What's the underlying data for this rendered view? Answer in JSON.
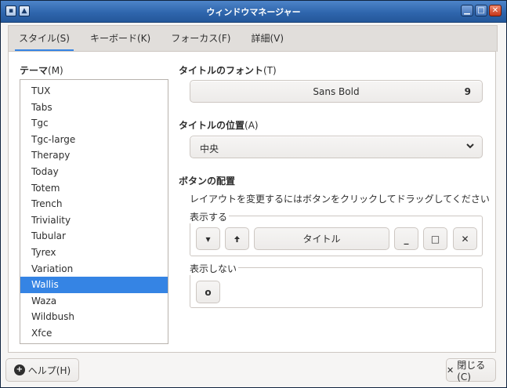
{
  "window": {
    "title": "ウィンドウマネージャー",
    "icons": [
      "app-menu-icon",
      "pin-icon"
    ],
    "controls": {
      "minimize": "▁",
      "maximize": "□",
      "close": "✕"
    }
  },
  "tabs": [
    {
      "label": "スタイル(S)",
      "active": true
    },
    {
      "label": "キーボード(K)",
      "active": false
    },
    {
      "label": "フォーカス(F)",
      "active": false
    },
    {
      "label": "詳細(V)",
      "active": false
    }
  ],
  "theme": {
    "label_main": "テーマ",
    "label_key": "(M)",
    "items": [
      "TUX",
      "Tabs",
      "Tgc",
      "Tgc-large",
      "Therapy",
      "Today",
      "Totem",
      "Trench",
      "Triviality",
      "Tubular",
      "Tyrex",
      "Variation",
      "Wallis",
      "Waza",
      "Wildbush",
      "Xfce"
    ],
    "selected": "Wallis"
  },
  "title_font": {
    "label_main": "タイトルのフォント",
    "label_key": "(T)",
    "font_name": "Sans Bold",
    "font_size": "9"
  },
  "title_position": {
    "label_main": "タイトルの位置",
    "label_key": "(A)",
    "value": "中央"
  },
  "button_layout": {
    "label": "ボタンの配置",
    "hint": "レイアウトを変更するにはボタンをクリックしてドラッグしてください",
    "shown_label": "表示する",
    "hidden_label": "表示しない",
    "shown": {
      "menu": "▾",
      "stick": "🠕",
      "title": "タイトル",
      "minimize": "_",
      "maximize": "□",
      "close": "✕"
    },
    "hidden": {
      "shade": "o"
    }
  },
  "footer": {
    "help": "ヘルプ(H)",
    "close": "閉じる(C)",
    "close_glyph": "✕"
  },
  "colors": {
    "accent": "#3584e4",
    "titlebar": "#2f66ad"
  }
}
